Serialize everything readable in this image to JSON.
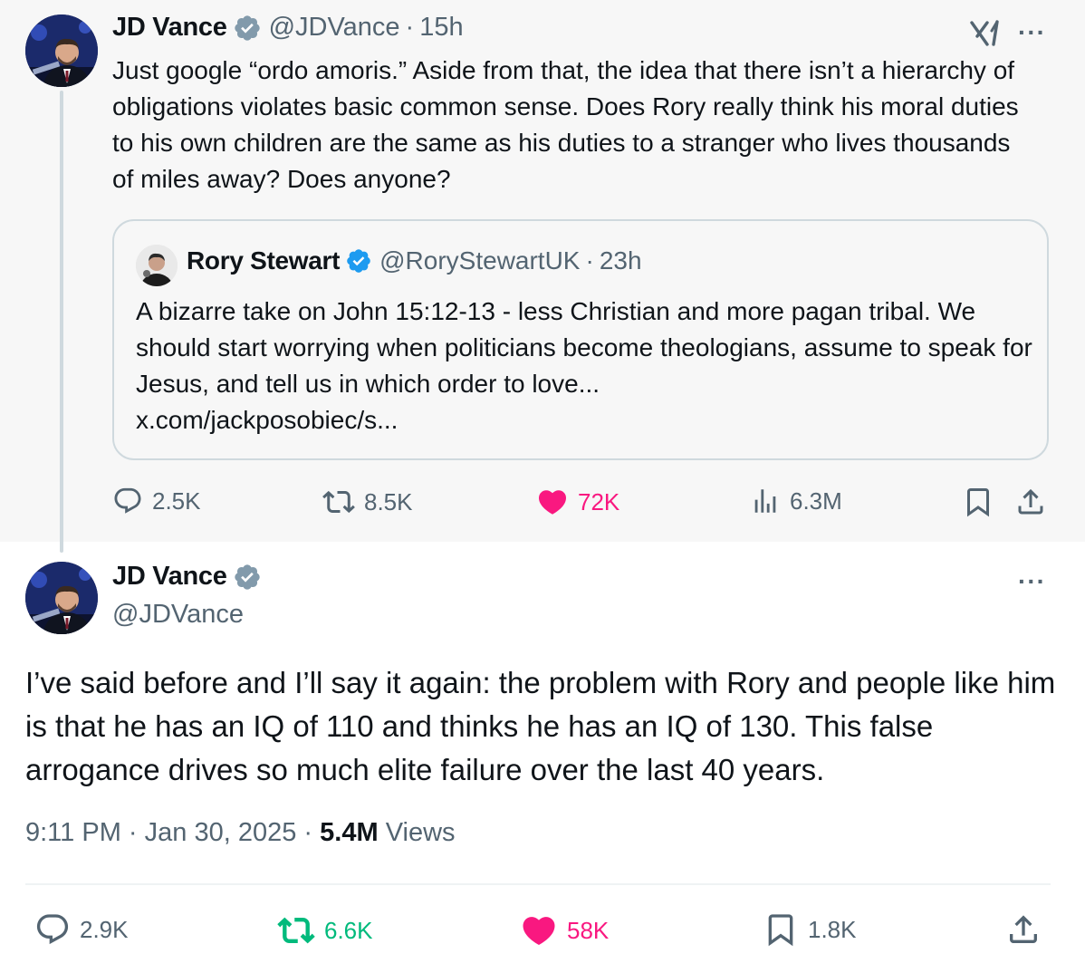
{
  "parent_tweet": {
    "author_name": "JD Vance",
    "handle": "@JDVance",
    "separator": "·",
    "time": "15h",
    "more": "···",
    "text": "Just google “ordo amoris.” Aside from that, the idea that there isn’t a hierarchy of obligations violates basic common sense. Does Rory really think his moral duties to his own children are the same as his duties to a stranger who lives thousands of miles away? Does anyone?",
    "quote": {
      "author_name": "Rory Stewart",
      "handle": "@RoryStewartUK",
      "separator": "·",
      "time": "23h",
      "text": "A bizarre take on John 15:12-13  - less Christian and more pagan tribal. We should start worrying when politicians become theologians, assume to speak for Jesus, and tell us in which order to love...",
      "link": "x.com/jackposobiec/s..."
    },
    "actions": {
      "replies": "2.5K",
      "reposts": "8.5K",
      "likes": "72K",
      "views": "6.3M"
    }
  },
  "main_tweet": {
    "author_name": "JD Vance",
    "handle": "@JDVance",
    "more": "···",
    "text": "I’ve said before and I’ll say it again: the problem with Rory and people like him is that he has an IQ of 110 and thinks he has an IQ of 130.  This false arrogance drives so much elite failure over the last 40 years.",
    "time": "9:11 PM",
    "separator": "·",
    "date": "Jan 30, 2025",
    "views_count": "5.4M",
    "views_label": "Views",
    "actions": {
      "replies": "2.9K",
      "reposts": "6.6K",
      "likes": "58K",
      "bookmarks": "1.8K"
    }
  },
  "colors": {
    "verified": "#1d9bf0",
    "like": "#f91880",
    "repost_active": "#00ba7c",
    "muted": "#536471"
  },
  "icons": [
    "verified-badge-icon",
    "grok-icon",
    "more-icon",
    "reply-icon",
    "repost-icon",
    "like-icon",
    "views-icon",
    "bookmark-icon",
    "share-icon"
  ]
}
